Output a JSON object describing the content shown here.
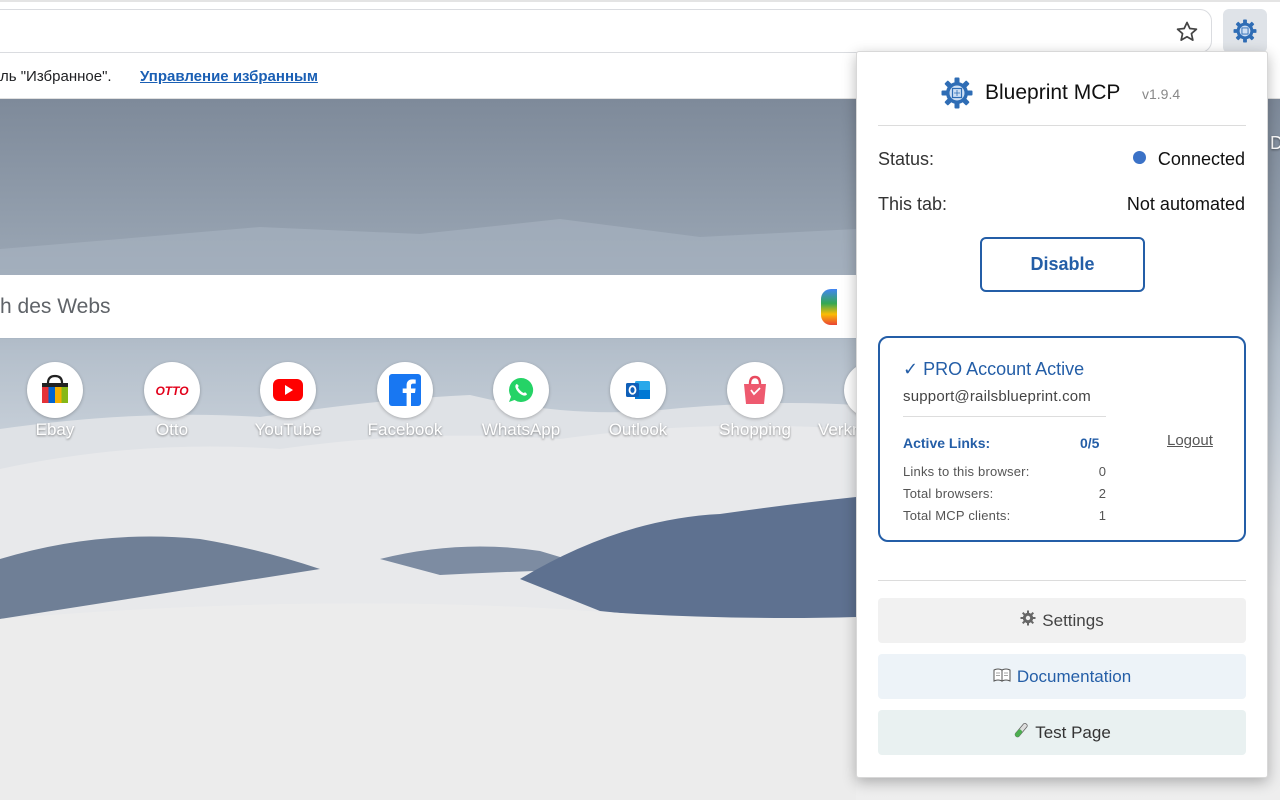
{
  "infobar": {
    "text": "ль \"Избранное\".",
    "link": "Управление избранным"
  },
  "ntp": {
    "search_placeholder": "h des Webs",
    "edge_letter": "D",
    "shortcuts": [
      {
        "label": "Ebay",
        "icon": "ebay-shopping-bag-icon"
      },
      {
        "label": "Otto",
        "icon": "otto-logo-icon",
        "logo_text": "OTTO"
      },
      {
        "label": "YouTube",
        "icon": "youtube-icon"
      },
      {
        "label": "Facebook",
        "icon": "facebook-icon"
      },
      {
        "label": "WhatsApp",
        "icon": "whatsapp-icon"
      },
      {
        "label": "Outlook",
        "icon": "outlook-icon"
      },
      {
        "label": "Shopping",
        "icon": "shopping-bag-icon"
      },
      {
        "label": "Verkn",
        "icon": "partial-shortcut-icon"
      }
    ]
  },
  "popup": {
    "title": "Blueprint MCP",
    "version": "v1.9.4",
    "status_label": "Status:",
    "status_value": "Connected",
    "status_color": "#3b72c7",
    "tab_label": "This tab:",
    "tab_value": "Not automated",
    "disable_label": "Disable",
    "pro": {
      "title": "✓ PRO Account Active",
      "email": "support@railsblueprint.com",
      "links_title": "Active Links:",
      "links_count": "0/5",
      "logout": "Logout",
      "stats": [
        {
          "label": "Links to this browser:",
          "value": "0"
        },
        {
          "label": "Total browsers:",
          "value": "2"
        },
        {
          "label": "Total MCP clients:",
          "value": "1"
        }
      ]
    },
    "settings_label": "Settings",
    "docs_label": "Documentation",
    "test_label": "Test Page",
    "accent_color": "#245ea7"
  }
}
